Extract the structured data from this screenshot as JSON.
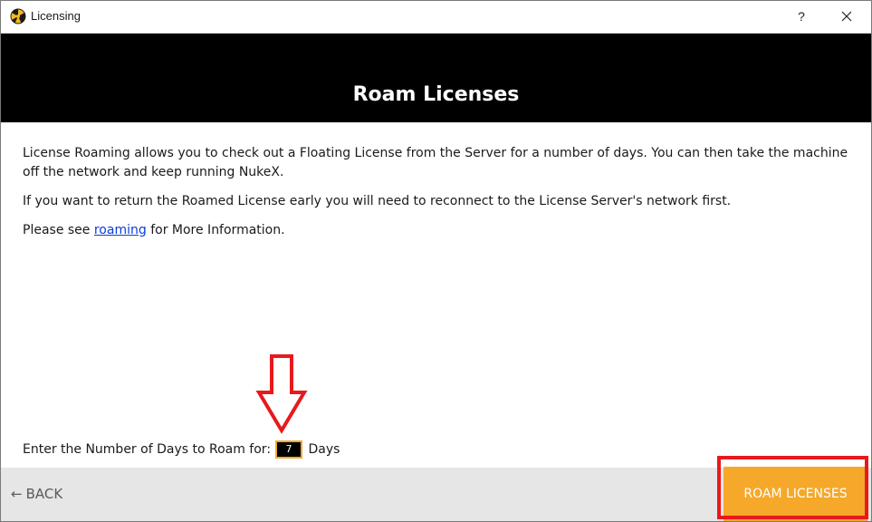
{
  "window": {
    "title": "Licensing",
    "help_label": "?",
    "icon": "nukex-radiation-icon"
  },
  "banner": {
    "title": "Roam Licenses"
  },
  "content": {
    "paragraph1": "License Roaming allows you to check out a Floating License from the Server for a number of days. You can then take the machine off the network and keep running NukeX.",
    "paragraph2": "If you want to return the Roamed License early you will need to reconnect to the License Server's network first.",
    "paragraph3_before": "Please see",
    "paragraph3_link": "roaming",
    "paragraph3_after": "for More Information."
  },
  "days": {
    "label": "Enter the Number of Days to Roam for:",
    "value": "7",
    "unit": "Days"
  },
  "footer": {
    "back_label": "BACK",
    "back_arrow": "←",
    "roam_label": "ROAM LICENSES"
  },
  "colors": {
    "accent": "#f5a829",
    "annotation": "#e8191d",
    "banner": "#000000",
    "link": "#0b3dd6"
  }
}
